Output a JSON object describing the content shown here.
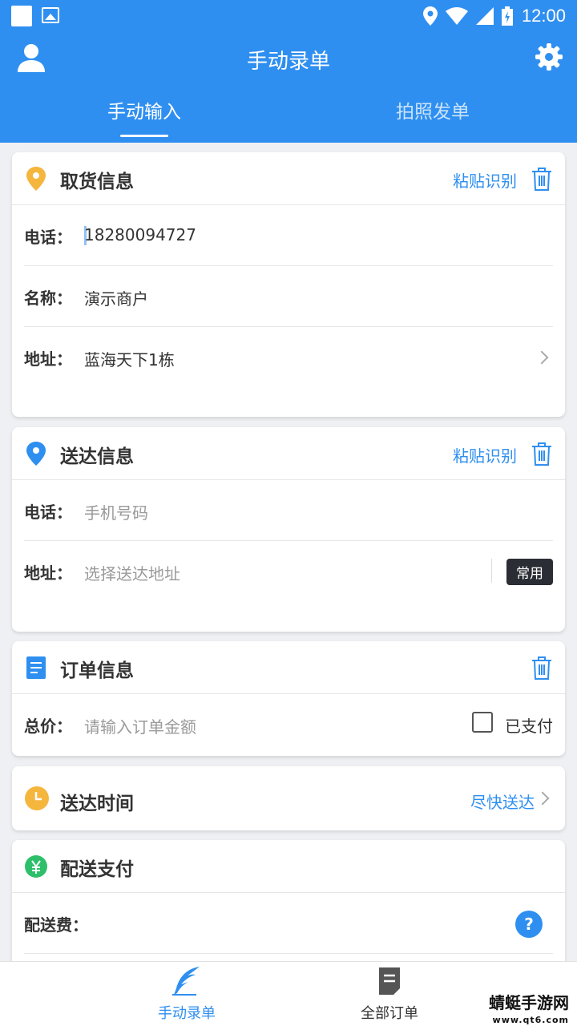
{
  "status_bar": {
    "time": "12:00"
  },
  "app_bar": {
    "title": "手动录单"
  },
  "tabs": [
    {
      "label": "手动输入",
      "active": true
    },
    {
      "label": "拍照发单",
      "active": false
    }
  ],
  "pickup": {
    "title": "取货信息",
    "paste_label": "粘贴识别",
    "phone_label": "电话：",
    "phone_value": "18280094727",
    "name_label": "名称：",
    "name_value": "演示商户",
    "address_label": "地址：",
    "address_value": "蓝海天下1栋"
  },
  "delivery": {
    "title": "送达信息",
    "paste_label": "粘贴识别",
    "phone_label": "电话：",
    "phone_placeholder": "手机号码",
    "address_label": "地址：",
    "address_placeholder": "选择送达地址",
    "common_label": "常用"
  },
  "order": {
    "title": "订单信息",
    "total_label": "总价：",
    "total_placeholder": "请输入订单金额",
    "paid_label": "已支付"
  },
  "delivery_time": {
    "title": "送达时间",
    "value": "尽快送达"
  },
  "payment": {
    "title": "配送支付",
    "fee_label": "配送费：",
    "help": "?"
  },
  "bottom_nav": [
    {
      "label": "手动录单",
      "active": true
    },
    {
      "label": "全部订单",
      "active": false
    }
  ],
  "watermark": {
    "title": "蜻蜓手游网",
    "url": "www.qt6.com"
  },
  "colors": {
    "primary": "#2f8ff0",
    "pickup_pin": "#f5b63e",
    "clock": "#f5b63e",
    "pay": "#2ebf6b"
  }
}
